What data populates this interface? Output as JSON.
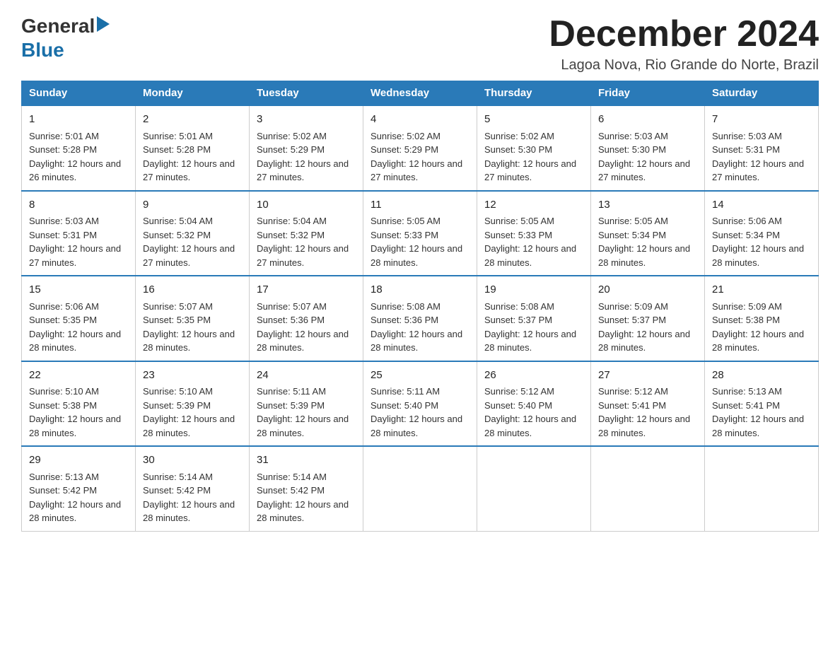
{
  "header": {
    "logo_general": "General",
    "logo_blue": "Blue",
    "month_title": "December 2024",
    "location": "Lagoa Nova, Rio Grande do Norte, Brazil"
  },
  "days_of_week": [
    "Sunday",
    "Monday",
    "Tuesday",
    "Wednesday",
    "Thursday",
    "Friday",
    "Saturday"
  ],
  "weeks": [
    [
      {
        "day": "1",
        "sunrise": "5:01 AM",
        "sunset": "5:28 PM",
        "daylight": "12 hours and 26 minutes."
      },
      {
        "day": "2",
        "sunrise": "5:01 AM",
        "sunset": "5:28 PM",
        "daylight": "12 hours and 27 minutes."
      },
      {
        "day": "3",
        "sunrise": "5:02 AM",
        "sunset": "5:29 PM",
        "daylight": "12 hours and 27 minutes."
      },
      {
        "day": "4",
        "sunrise": "5:02 AM",
        "sunset": "5:29 PM",
        "daylight": "12 hours and 27 minutes."
      },
      {
        "day": "5",
        "sunrise": "5:02 AM",
        "sunset": "5:30 PM",
        "daylight": "12 hours and 27 minutes."
      },
      {
        "day": "6",
        "sunrise": "5:03 AM",
        "sunset": "5:30 PM",
        "daylight": "12 hours and 27 minutes."
      },
      {
        "day": "7",
        "sunrise": "5:03 AM",
        "sunset": "5:31 PM",
        "daylight": "12 hours and 27 minutes."
      }
    ],
    [
      {
        "day": "8",
        "sunrise": "5:03 AM",
        "sunset": "5:31 PM",
        "daylight": "12 hours and 27 minutes."
      },
      {
        "day": "9",
        "sunrise": "5:04 AM",
        "sunset": "5:32 PM",
        "daylight": "12 hours and 27 minutes."
      },
      {
        "day": "10",
        "sunrise": "5:04 AM",
        "sunset": "5:32 PM",
        "daylight": "12 hours and 27 minutes."
      },
      {
        "day": "11",
        "sunrise": "5:05 AM",
        "sunset": "5:33 PM",
        "daylight": "12 hours and 28 minutes."
      },
      {
        "day": "12",
        "sunrise": "5:05 AM",
        "sunset": "5:33 PM",
        "daylight": "12 hours and 28 minutes."
      },
      {
        "day": "13",
        "sunrise": "5:05 AM",
        "sunset": "5:34 PM",
        "daylight": "12 hours and 28 minutes."
      },
      {
        "day": "14",
        "sunrise": "5:06 AM",
        "sunset": "5:34 PM",
        "daylight": "12 hours and 28 minutes."
      }
    ],
    [
      {
        "day": "15",
        "sunrise": "5:06 AM",
        "sunset": "5:35 PM",
        "daylight": "12 hours and 28 minutes."
      },
      {
        "day": "16",
        "sunrise": "5:07 AM",
        "sunset": "5:35 PM",
        "daylight": "12 hours and 28 minutes."
      },
      {
        "day": "17",
        "sunrise": "5:07 AM",
        "sunset": "5:36 PM",
        "daylight": "12 hours and 28 minutes."
      },
      {
        "day": "18",
        "sunrise": "5:08 AM",
        "sunset": "5:36 PM",
        "daylight": "12 hours and 28 minutes."
      },
      {
        "day": "19",
        "sunrise": "5:08 AM",
        "sunset": "5:37 PM",
        "daylight": "12 hours and 28 minutes."
      },
      {
        "day": "20",
        "sunrise": "5:09 AM",
        "sunset": "5:37 PM",
        "daylight": "12 hours and 28 minutes."
      },
      {
        "day": "21",
        "sunrise": "5:09 AM",
        "sunset": "5:38 PM",
        "daylight": "12 hours and 28 minutes."
      }
    ],
    [
      {
        "day": "22",
        "sunrise": "5:10 AM",
        "sunset": "5:38 PM",
        "daylight": "12 hours and 28 minutes."
      },
      {
        "day": "23",
        "sunrise": "5:10 AM",
        "sunset": "5:39 PM",
        "daylight": "12 hours and 28 minutes."
      },
      {
        "day": "24",
        "sunrise": "5:11 AM",
        "sunset": "5:39 PM",
        "daylight": "12 hours and 28 minutes."
      },
      {
        "day": "25",
        "sunrise": "5:11 AM",
        "sunset": "5:40 PM",
        "daylight": "12 hours and 28 minutes."
      },
      {
        "day": "26",
        "sunrise": "5:12 AM",
        "sunset": "5:40 PM",
        "daylight": "12 hours and 28 minutes."
      },
      {
        "day": "27",
        "sunrise": "5:12 AM",
        "sunset": "5:41 PM",
        "daylight": "12 hours and 28 minutes."
      },
      {
        "day": "28",
        "sunrise": "5:13 AM",
        "sunset": "5:41 PM",
        "daylight": "12 hours and 28 minutes."
      }
    ],
    [
      {
        "day": "29",
        "sunrise": "5:13 AM",
        "sunset": "5:42 PM",
        "daylight": "12 hours and 28 minutes."
      },
      {
        "day": "30",
        "sunrise": "5:14 AM",
        "sunset": "5:42 PM",
        "daylight": "12 hours and 28 minutes."
      },
      {
        "day": "31",
        "sunrise": "5:14 AM",
        "sunset": "5:42 PM",
        "daylight": "12 hours and 28 minutes."
      },
      null,
      null,
      null,
      null
    ]
  ],
  "labels": {
    "sunrise_prefix": "Sunrise: ",
    "sunset_prefix": "Sunset: ",
    "daylight_prefix": "Daylight: "
  }
}
